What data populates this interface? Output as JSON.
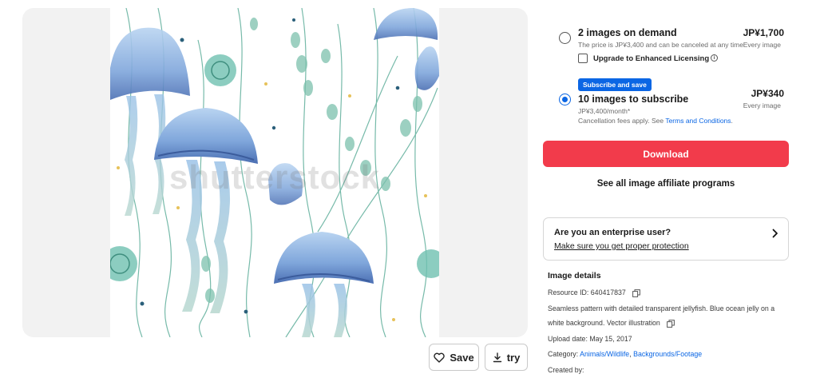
{
  "preview": {
    "watermark": "shutterstock",
    "save_label": "Save",
    "try_label": "try",
    "icons": {
      "save": "heart-icon",
      "try": "download-icon"
    }
  },
  "pricing": {
    "option_demand": {
      "title": "2 images on demand",
      "description": "The price is JP¥3,400 and can be canceled at any time",
      "price": "JP¥1,700",
      "price_sub": "Every image",
      "selected": false,
      "enhanced_label": "Upgrade to Enhanced Licensing",
      "enhanced_checked": false
    },
    "option_subscribe": {
      "badge": "Subscribe and save",
      "title": "10 images to subscribe",
      "description": "JP¥3,400/month*",
      "fees_text": "Cancellation fees apply. See ",
      "fees_link": "Terms and Conditions",
      "fees_end": ".",
      "price": "JP¥340",
      "price_sub": "Every image",
      "selected": true
    }
  },
  "download_label": "Download",
  "affiliate_label": "See all image affiliate programs",
  "enterprise": {
    "title": "Are you an enterprise user?",
    "link": "Make sure you get proper protection"
  },
  "details": {
    "title": "Image details",
    "resource_label": "Resource ID: ",
    "resource_id": "640417837",
    "description_line1": "Seamless pattern with detailed transparent jellyfish. Blue ocean jelly on a",
    "description_line2": "white background. Vector illustration",
    "upload_label": "Upload date: ",
    "upload_date": "May 15, 2017",
    "category_label": "Category: ",
    "category_link1": "Animals/Wildlife",
    "category_sep": ", ",
    "category_link2": "Backgrounds/Footage",
    "created_by_label": "Created by:"
  },
  "colors": {
    "accent_blue": "#0b66e4",
    "download_red": "#f23b4b",
    "jelly_blue": "#8fb6e3",
    "jelly_dark": "#4a72b5",
    "seaweed_green": "#6fb8a8"
  }
}
